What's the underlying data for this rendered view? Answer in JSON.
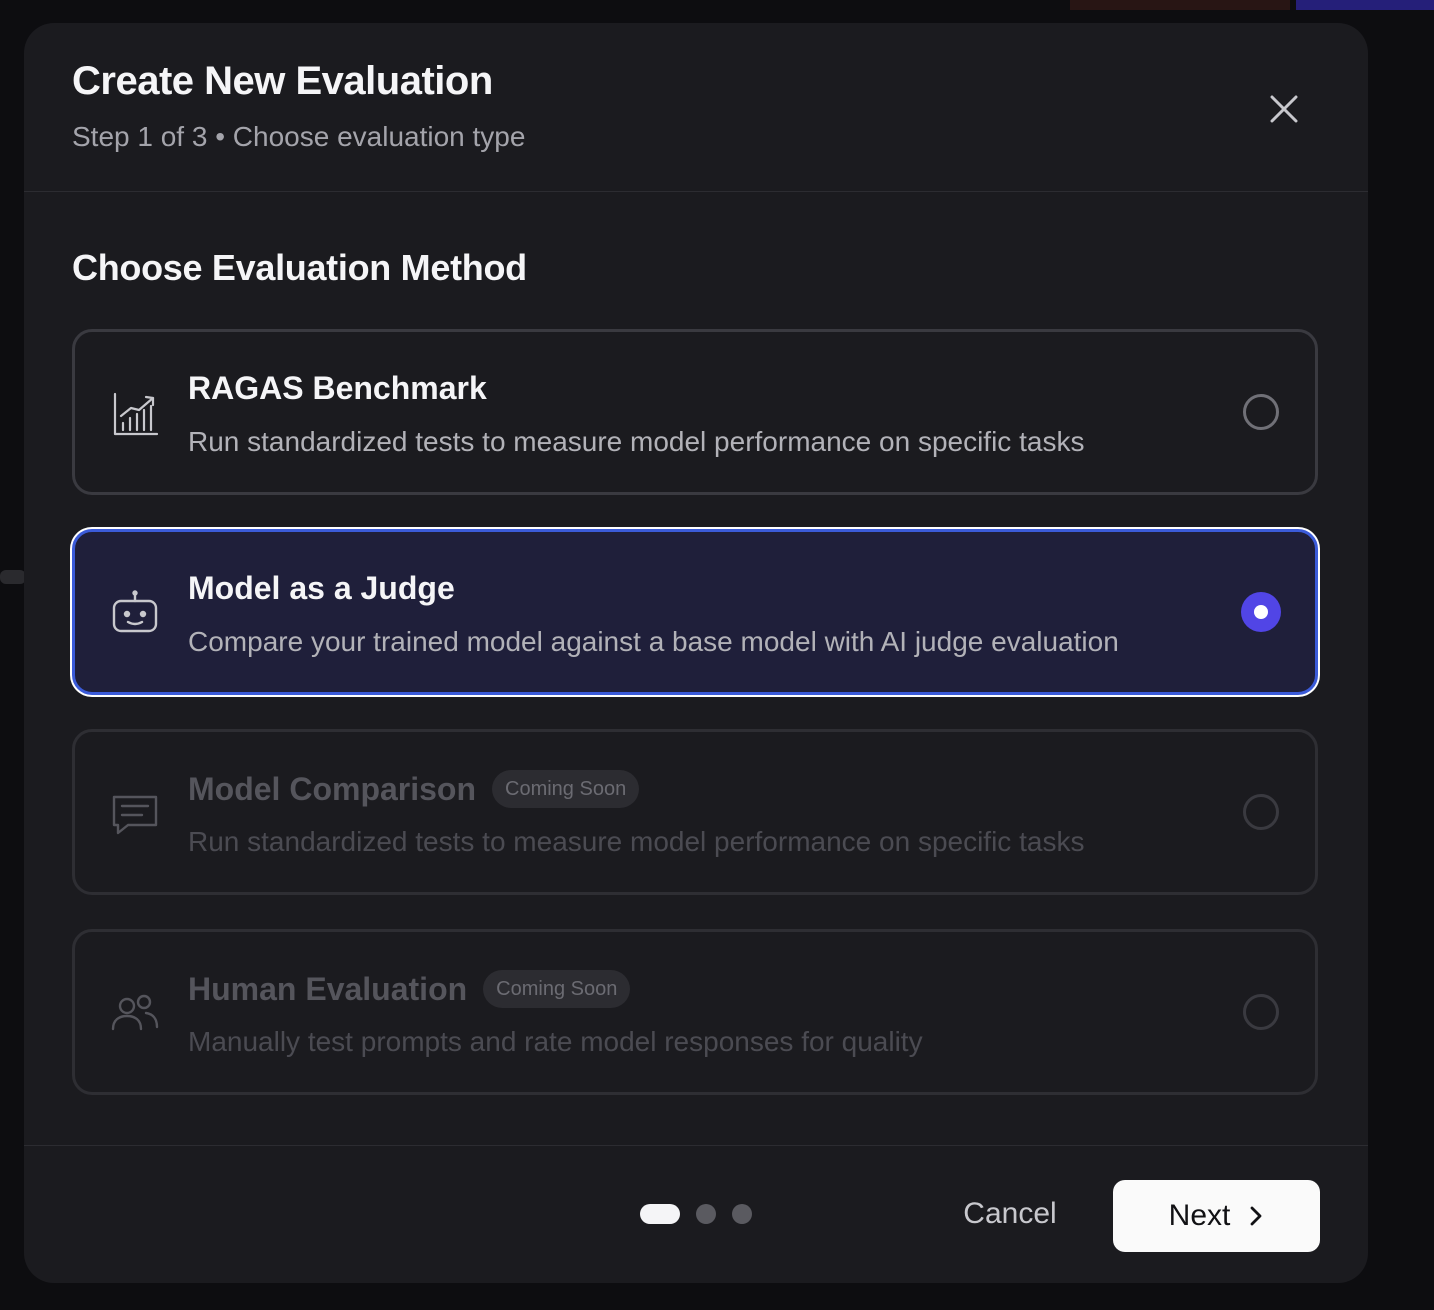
{
  "modal": {
    "title": "Create New Evaluation",
    "subtitle": "Step 1 of 3 • Choose evaluation type"
  },
  "section": {
    "title": "Choose Evaluation Method"
  },
  "options": [
    {
      "title": "RAGAS Benchmark",
      "description": "Run standardized tests to measure model performance on specific tasks",
      "icon": "chart-icon",
      "selected": false,
      "disabled": false,
      "badge": ""
    },
    {
      "title": "Model as a Judge",
      "description": "Compare your trained model against a base model with AI judge evaluation",
      "icon": "robot-icon",
      "selected": true,
      "disabled": false,
      "badge": ""
    },
    {
      "title": "Model Comparison",
      "description": "Run standardized tests to measure model performance on specific tasks",
      "icon": "message-icon",
      "selected": false,
      "disabled": true,
      "badge": "Coming Soon"
    },
    {
      "title": "Human Evaluation",
      "description": "Manually test prompts and rate model responses for quality",
      "icon": "users-icon",
      "selected": false,
      "disabled": true,
      "badge": "Coming Soon"
    }
  ],
  "footer": {
    "steps_total": 3,
    "current_step": 1,
    "cancel_label": "Cancel",
    "next_label": "Next"
  },
  "colors": {
    "accent": "#5145e6",
    "selected_border": "#3b5bd9",
    "selected_bg": "#1f1f3a",
    "modal_bg": "#1b1b1f"
  }
}
